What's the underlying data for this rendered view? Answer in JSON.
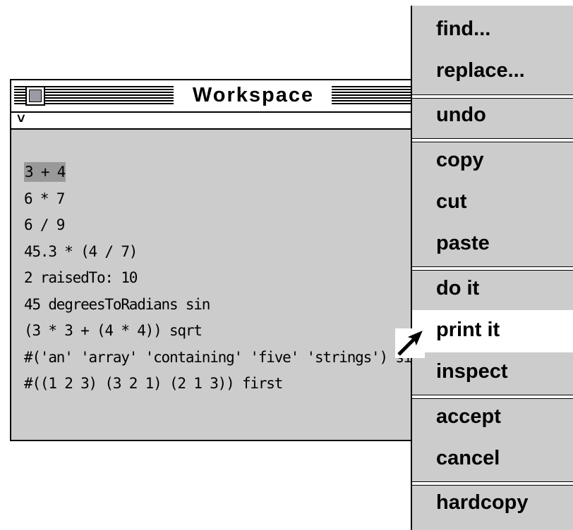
{
  "window": {
    "title": "Workspace",
    "pane_menu_glyph": "˅"
  },
  "workspace_lines": [
    "3 + 4",
    "6 * 7",
    "6 / 9",
    "45.3 * (4 / 7)",
    "2 raisedTo: 10",
    "45 degreesToRadians sin",
    "(3 * 3 + (4 * 4)) sqrt",
    "#('an' 'array' 'containing' 'five' 'strings') size",
    "#((1 2 3) (3 2 1) (2 1 3)) first"
  ],
  "menu": {
    "items": [
      {
        "label": "find..."
      },
      {
        "label": "replace..."
      },
      {
        "label": "undo"
      },
      {
        "label": "copy"
      },
      {
        "label": "cut"
      },
      {
        "label": "paste"
      },
      {
        "label": "do it"
      },
      {
        "label": "print it"
      },
      {
        "label": "inspect"
      },
      {
        "label": "accept"
      },
      {
        "label": "cancel"
      },
      {
        "label": "hardcopy"
      }
    ],
    "highlighted_item": "print it"
  },
  "icons": {
    "close_box": "close-box-icon",
    "cursor": "arrow-cursor-icon"
  }
}
